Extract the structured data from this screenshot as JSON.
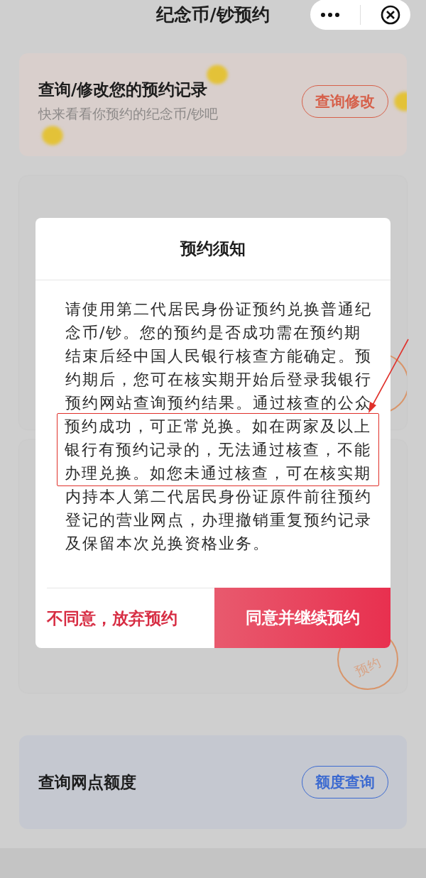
{
  "header": {
    "title": "纪念币/钞预约"
  },
  "cards": [
    {
      "kind": "promo",
      "title": "查询/修改您的预约记录",
      "subtitle": "快来看看你预约的纪念币/钞吧",
      "button": "查询修改"
    },
    {
      "kind": "covered"
    },
    {
      "kind": "covered",
      "stamp": "预约"
    },
    {
      "kind": "query",
      "title": "查询网点额度",
      "button": "额度查询"
    }
  ],
  "modal": {
    "title": "预约须知",
    "body": [
      {
        "text": "请使用第二代居民身份证预约兑换普通纪念币/钞。您的预约是否成功需在预约期结束后经中国人民银行核查方能确定。预约期后，您可在核实期开始后登录我银行预约网站查询预约结果。通过核查的公众",
        "highlighted": false
      },
      {
        "text": "预约成功，可正常兑换。如在两家及以上银行有预约记录的，无法通过核查，不能办理兑换。如您未通过核查，可在核实期",
        "highlighted": true
      },
      {
        "text": "内持本人第二代居民身份证原件前往预约登记的营业网点，办理撤销重复预约记录及保留本次兑换资格业务。",
        "highlighted": false
      }
    ],
    "buttons": [
      {
        "kind": "decline",
        "label": "不同意，放弃预约"
      },
      {
        "kind": "accept",
        "label": "同意并继续预约"
      }
    ],
    "annotation": {
      "kind": "box_with_arrow"
    }
  }
}
